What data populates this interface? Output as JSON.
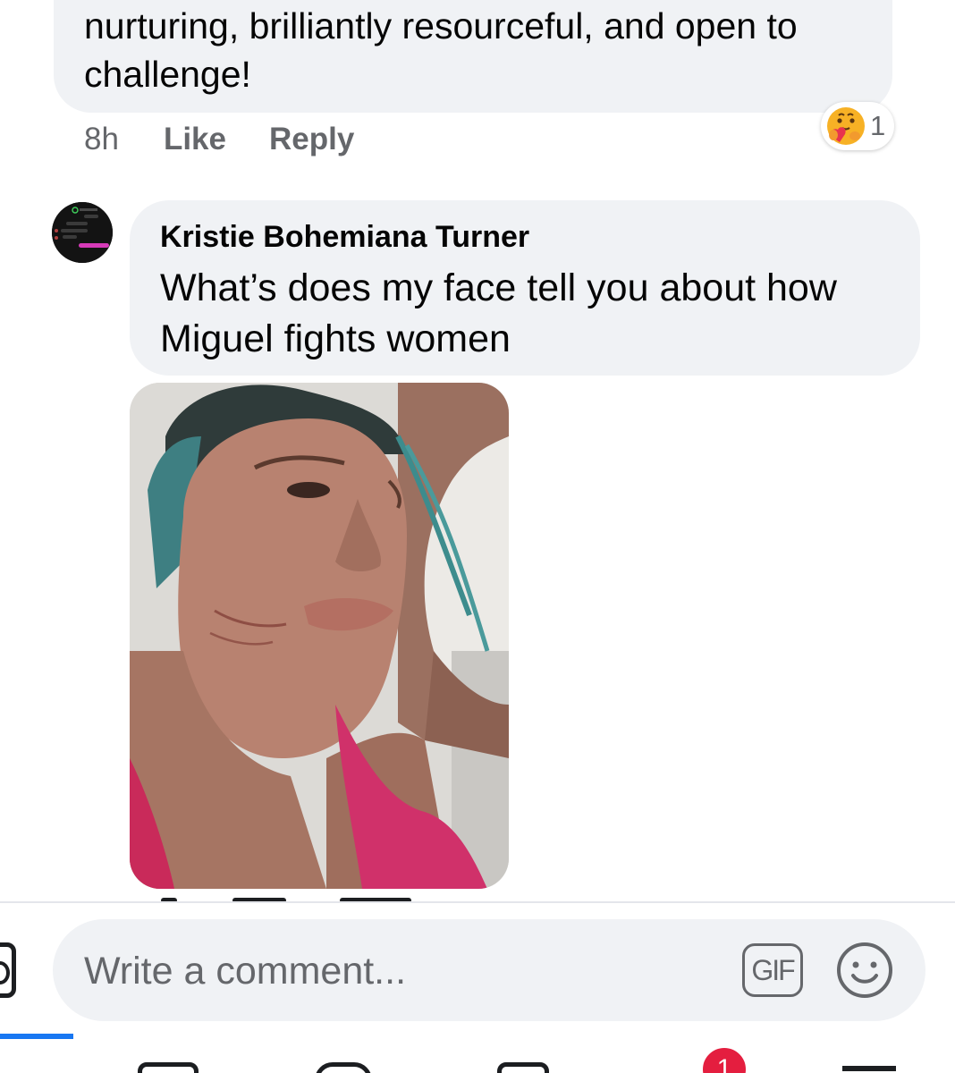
{
  "previous_comment": {
    "text": "nurturing, brilliantly resourceful, and open to challenge!",
    "time": "8h",
    "like_label": "Like",
    "reply_label": "Reply",
    "reaction_icon": "care-emoji-icon",
    "reaction_count": "1"
  },
  "comment": {
    "author": "Kristie Bohemiana Turner",
    "text": "What’s does my face tell you about how Miguel fights women",
    "avatar_icon": "dark-screenshot-avatar",
    "attachment": "photo"
  },
  "composer": {
    "placeholder": "Write a comment...",
    "gif_label": "GIF",
    "camera_icon": "camera-icon",
    "emoji_icon": "emoji-icon"
  },
  "bottom_nav": {
    "notifications_badge": "1",
    "accent_color": "#1877f2",
    "badge_color": "#e41e3f"
  }
}
